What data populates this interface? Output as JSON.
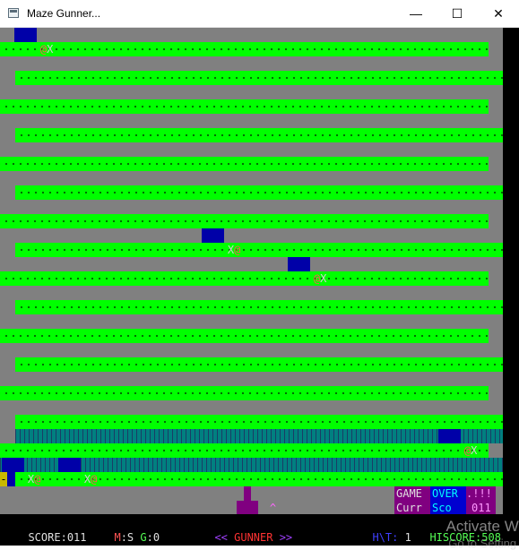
{
  "window": {
    "title": "Maze Gunner...",
    "minimize_glyph": "—",
    "maximize_glyph": "☐",
    "close_glyph": "✕"
  },
  "colors": {
    "floor": "#808080",
    "wall": "#00ff00",
    "wall_dot": "#006000",
    "enemy_bg": "#0000a8",
    "enemy_at": "#ff5555",
    "player_bg": "#800080",
    "teal": "#008080"
  },
  "enemies": [
    {
      "name": "enemy-top-left",
      "glyph_at": "@",
      "glyph_x": "X",
      "facing": "right"
    },
    {
      "name": "enemy-mid-1",
      "glyph_at": "@",
      "glyph_x": "X",
      "facing": "left"
    },
    {
      "name": "enemy-mid-2",
      "glyph_at": "@",
      "glyph_x": "X",
      "facing": "right"
    },
    {
      "name": "enemy-lower-right",
      "glyph_at": "@",
      "glyph_x": "X",
      "facing": "right"
    },
    {
      "name": "enemy-lower-left-1",
      "glyph_at": "@",
      "glyph_x": "X",
      "facing": "left"
    },
    {
      "name": "enemy-lower-left-2",
      "glyph_at": "@",
      "glyph_x": "X",
      "facing": "left"
    }
  ],
  "player": {
    "cannon": "^",
    "body": "!*!"
  },
  "left_marker": "-",
  "panel": {
    "game": "GAME",
    "over": "OVER",
    "bangs": ".!!!",
    "curr": "Curr",
    "sco": "Sco",
    "score_tail": "011"
  },
  "hud": {
    "score_label": "SCORE:",
    "score_value": "011",
    "m": "M",
    "s_sep": ":S",
    "g": " G",
    "g_value": ":0",
    "gunner_left": "<<",
    "gunner": " GUNNER ",
    "gunner_right": ">>",
    "h": "H",
    "t_label": "\\T:",
    "t_value": " 1",
    "hiscore_label": "HISCORE:",
    "hiscore_value": "508"
  },
  "watermark": {
    "line1": "Activate W",
    "line2": "Go to Setting"
  }
}
